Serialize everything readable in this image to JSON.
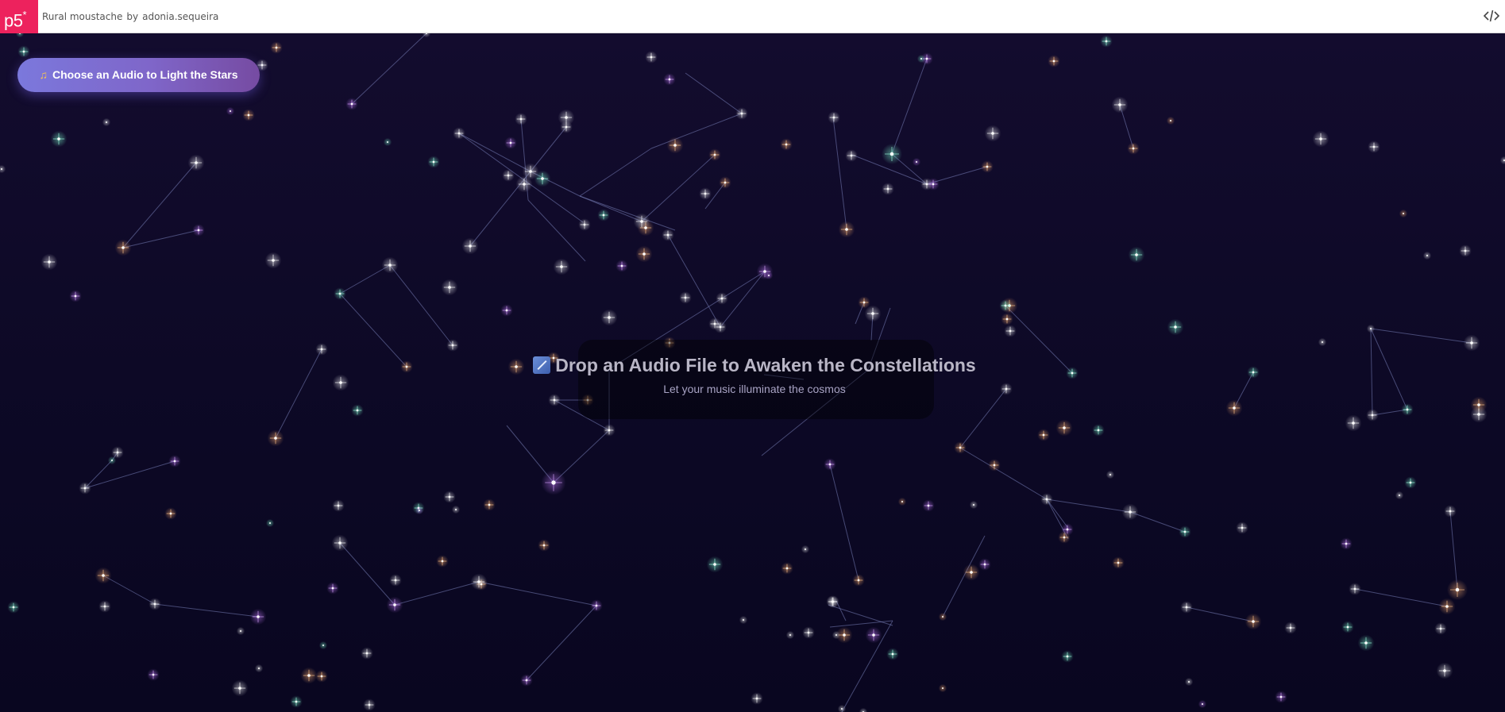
{
  "header": {
    "logo": "p5",
    "logo_sup": "*",
    "sketch_name": "Rural moustache",
    "by_label": "by",
    "author": "adonia.sequeira",
    "code_icon": "code-brackets-icon"
  },
  "controls": {
    "choose_audio_label": "Choose an Audio to Light the Stars",
    "choose_audio_icon": "music-note-icon"
  },
  "drop_zone": {
    "title": "Drop an Audio File to Awaken the Constellations",
    "title_icon": "shooting-star-icon",
    "subtitle": "Let your music illuminate the cosmos"
  },
  "colors": {
    "background_top": "#130c2e",
    "background_bottom": "#090620",
    "button_start": "#7b78dc",
    "button_end": "#764ba2",
    "star_white": "#ffffff",
    "star_purple": "#c77dff",
    "star_orange": "#ffb070",
    "star_green": "#7fffd0",
    "line": "#7880b8",
    "brand": "#ed225d"
  }
}
